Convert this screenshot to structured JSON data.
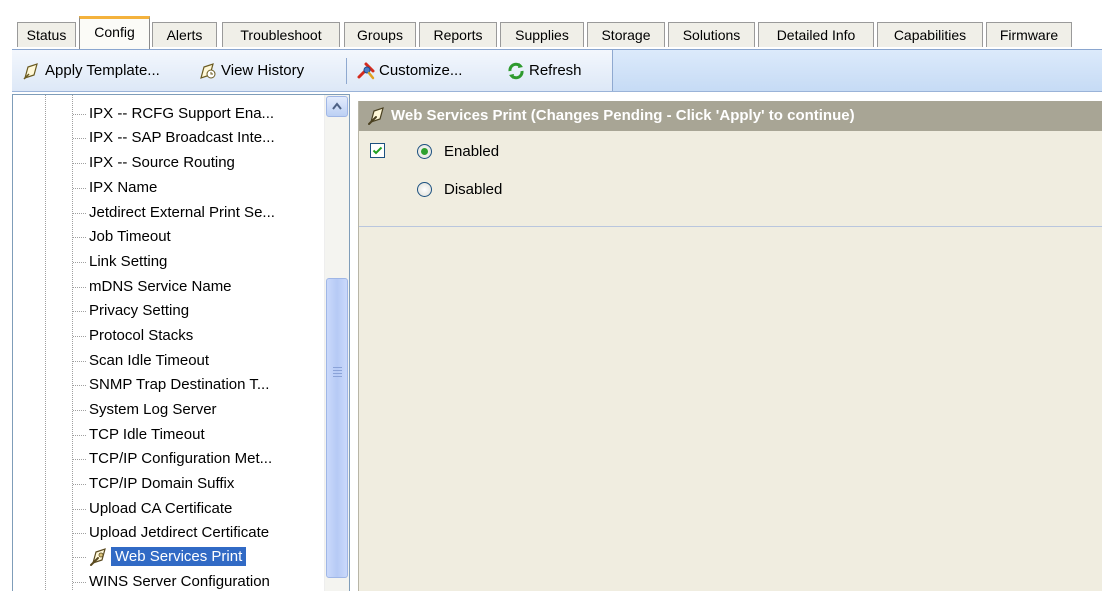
{
  "tabs": [
    {
      "label": "Status",
      "active": false
    },
    {
      "label": "Config",
      "active": true
    },
    {
      "label": "Alerts",
      "active": false
    },
    {
      "label": "Troubleshoot",
      "active": false
    },
    {
      "label": "Groups",
      "active": false
    },
    {
      "label": "Reports",
      "active": false
    },
    {
      "label": "Supplies",
      "active": false
    },
    {
      "label": "Storage",
      "active": false
    },
    {
      "label": "Solutions",
      "active": false
    },
    {
      "label": "Detailed Info",
      "active": false
    },
    {
      "label": "Capabilities",
      "active": false
    },
    {
      "label": "Firmware",
      "active": false
    }
  ],
  "toolbar": {
    "apply_template": "Apply Template...",
    "view_history": "View History",
    "customize": "Customize...",
    "refresh": "Refresh"
  },
  "tree": {
    "items": [
      "IPX -- RCFG Support Ena...",
      "IPX -- SAP Broadcast Inte...",
      "IPX -- Source Routing",
      "IPX Name",
      "Jetdirect External Print Se...",
      "Job Timeout",
      "Link Setting",
      "mDNS Service Name",
      "Privacy Setting",
      "Protocol Stacks",
      "Scan Idle Timeout",
      "SNMP Trap Destination T...",
      "System Log Server",
      "TCP Idle Timeout",
      "TCP/IP Configuration Met...",
      "TCP/IP Domain Suffix",
      "Upload CA Certificate",
      "Upload Jetdirect Certificate",
      "Web Services Print",
      "WINS Server Configuration"
    ],
    "selected": "Web Services Print"
  },
  "panel": {
    "title": "Web Services Print (Changes Pending - Click 'Apply' to continue)",
    "checkbox_checked": true,
    "options": [
      {
        "label": "Enabled",
        "selected": true
      },
      {
        "label": "Disabled",
        "selected": false
      }
    ]
  },
  "colors": {
    "selection": "#316ac5",
    "header": "#a8a595",
    "panel_bg": "#f0ede0",
    "active_tab_accent": "#f4b23c",
    "toolbar": "#c6dbf5"
  },
  "icons": {
    "apply_template": "template-icon",
    "view_history": "history-icon",
    "customize": "customize-icon",
    "refresh": "refresh-icon",
    "setting": "setting-wrench-icon"
  }
}
